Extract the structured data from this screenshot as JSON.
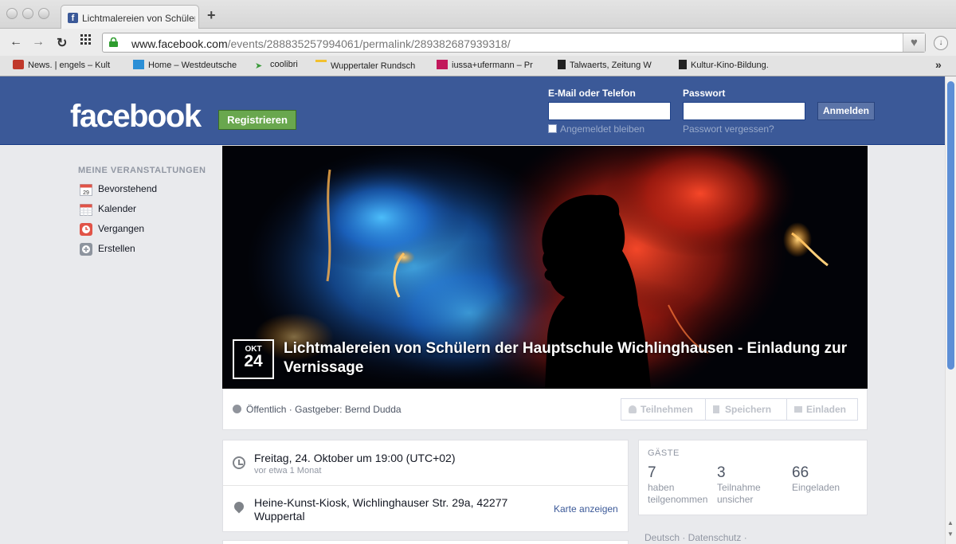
{
  "browser": {
    "tab_title": "Lichtmalereien von Schülern",
    "tab_favicon": "f",
    "url_host": "www.facebook.com",
    "url_path": "/events/288835257994061/permalink/289382687939318/",
    "bookmarks": [
      {
        "label": "News. | engels – Kult",
        "icon": "engels-icon"
      },
      {
        "label": "Home – Westdeutsche",
        "icon": "wz-icon"
      },
      {
        "label": "coolibri",
        "icon": "coolibri-icon"
      },
      {
        "label": "Wuppertaler Rundsch",
        "icon": "rundschau-icon"
      },
      {
        "label": "iussa+ufermann – Pr",
        "icon": "iussa-icon"
      },
      {
        "label": "Talwaerts, Zeitung W",
        "icon": "document-icon"
      },
      {
        "label": "Kultur-Kino-Bildung.",
        "icon": "document-icon"
      }
    ]
  },
  "header": {
    "logo": "facebook",
    "register_label": "Registrieren",
    "email_label": "E-Mail oder Telefon",
    "password_label": "Passwort",
    "login_label": "Anmelden",
    "remember_label": "Angemeldet bleiben",
    "forgot_label": "Passwort vergessen?"
  },
  "leftnav": {
    "header": "MEINE VERANSTALTUNGEN",
    "items": [
      {
        "label": "Bevorstehend",
        "icon": "calendar-day-icon",
        "badge": "29"
      },
      {
        "label": "Kalender",
        "icon": "calendar-icon"
      },
      {
        "label": "Vergangen",
        "icon": "clock-icon"
      },
      {
        "label": "Erstellen",
        "icon": "plus-icon"
      }
    ]
  },
  "event": {
    "month": "OKT",
    "day": "24",
    "title": "Lichtmalereien von Schülern der Hauptschule Wichlinghausen - Einladung zur Vernissage",
    "privacy": "Öffentlich · Gastgeber: Bernd Dudda",
    "actions": {
      "join": "Teilnehmen",
      "save": "Speichern",
      "invite": "Einladen"
    },
    "datetime": "Freitag, 24. Oktober um 19:00 (UTC+02)",
    "datetime_sub": "vor etwa 1 Monat",
    "location": "Heine-Kunst-Kiosk, Wichlinghauser Str. 29a, 42277 Wuppertal",
    "map_link": "Karte anzeigen"
  },
  "guests": {
    "header": "GÄSTE",
    "stats": [
      {
        "count": "7",
        "label": "haben teilgenommen"
      },
      {
        "count": "3",
        "label": "Teilnahme unsicher"
      },
      {
        "count": "66",
        "label": "Eingeladen"
      }
    ]
  },
  "footer": "Deutsch · Datenschutz ·",
  "colors": {
    "fb_blue": "#3b5998",
    "register_green": "#69a74e",
    "page_bg": "#e9eaed"
  }
}
